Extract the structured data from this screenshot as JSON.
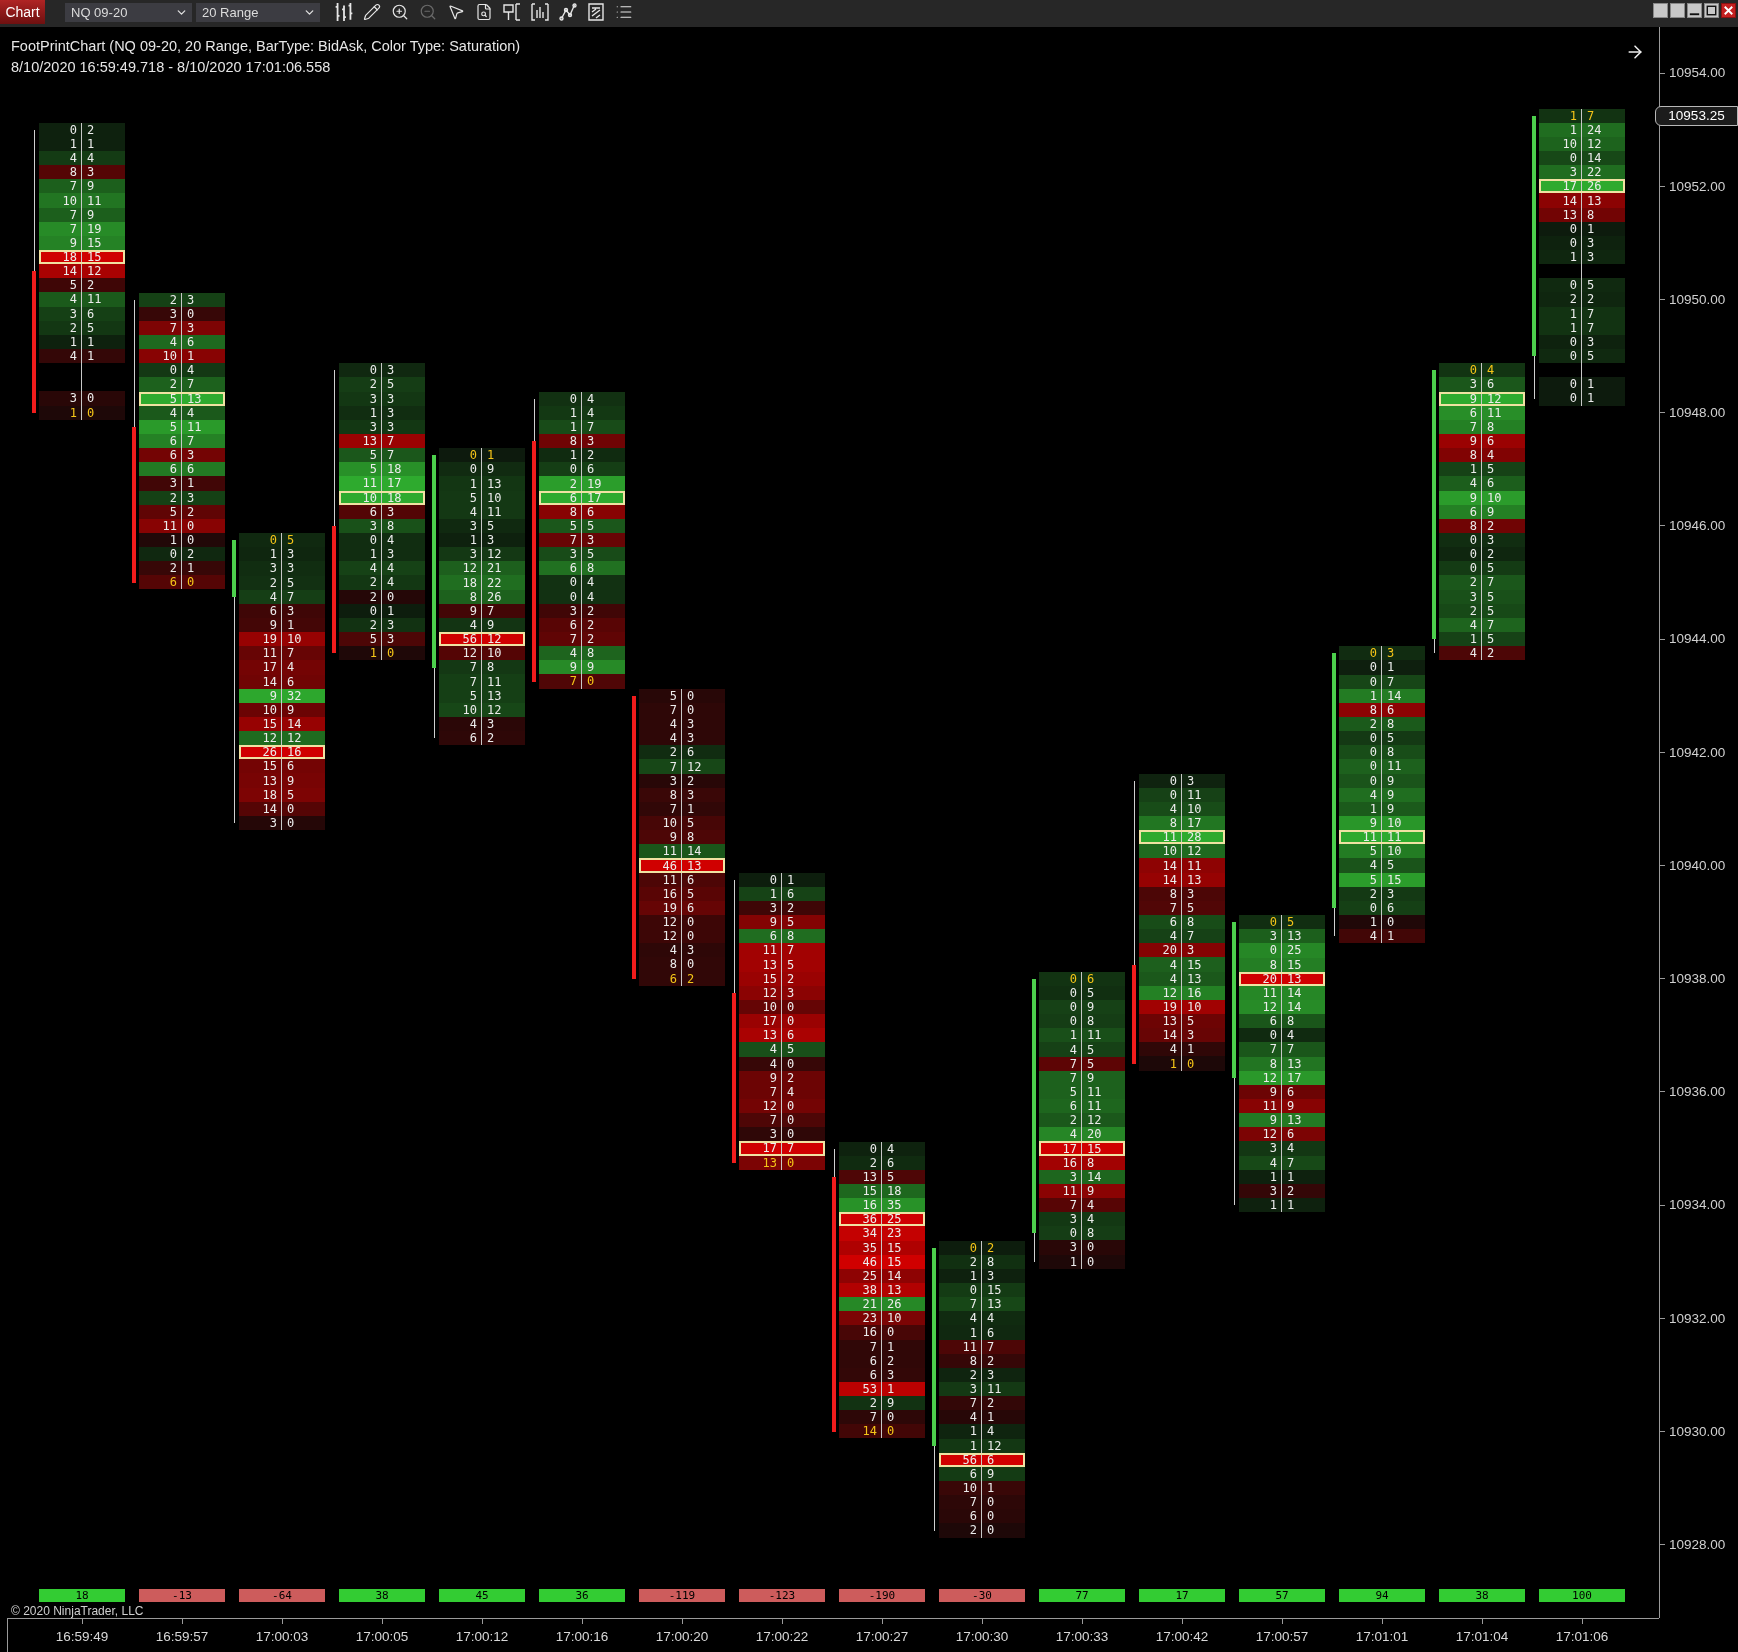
{
  "toolbar": {
    "tab": "Chart",
    "instrument": "NQ 09-20",
    "bar_type": "20 Range",
    "tools": [
      {
        "disabled": false
      },
      {
        "disabled": false
      },
      {
        "disabled": false
      },
      {
        "disabled": true
      },
      {
        "disabled": false
      },
      {
        "disabled": false
      },
      {
        "disabled": false
      },
      {
        "disabled": false
      },
      {
        "disabled": false
      },
      {
        "disabled": false
      },
      {
        "disabled": false
      }
    ]
  },
  "chart": {
    "title": "FootPrintChart (NQ 09-20, 20 Range, BarType: BidAsk, Color Type: Saturation)",
    "time_range": "8/10/2020 16:59:49.718 - 8/10/2020 17:01:06.558"
  },
  "price_axis": {
    "labels": [
      "10954.00",
      "10952.00",
      "10950.00",
      "10948.00",
      "10946.00",
      "10944.00",
      "10942.00",
      "10940.00",
      "10938.00",
      "10936.00",
      "10934.00",
      "10932.00",
      "10930.00",
      "10928.00"
    ],
    "current_price": "10953.25"
  },
  "bars": [
    {
      "rows": [
        {
          "bid": "0",
          "ask": "2",
          "kind": "normal"
        },
        {
          "bid": "1",
          "ask": "1",
          "kind": "normal"
        },
        {
          "bid": "4",
          "ask": "4",
          "kind": "normal"
        },
        {
          "bid": "8",
          "ask": "3",
          "kind": "normal"
        },
        {
          "bid": "7",
          "ask": "9",
          "kind": "normal"
        },
        {
          "bid": "10",
          "ask": "11",
          "kind": "normal"
        },
        {
          "bid": "7",
          "ask": "9",
          "kind": "normal"
        },
        {
          "bid": "7",
          "ask": "19",
          "kind": "normal"
        },
        {
          "bid": "9",
          "ask": "15",
          "kind": "normal"
        },
        {
          "bid": "18",
          "ask": "15",
          "kind": "poc"
        },
        {
          "bid": "14",
          "ask": "12",
          "kind": "open"
        },
        {
          "bid": "5",
          "ask": "2",
          "kind": "normal"
        },
        {
          "bid": "4",
          "ask": "11",
          "kind": "normal"
        },
        {
          "bid": "3",
          "ask": "6",
          "kind": "normal"
        },
        {
          "bid": "2",
          "ask": "5",
          "kind": "normal"
        },
        {
          "bid": "1",
          "ask": "1",
          "kind": "normal"
        },
        {
          "bid": "4",
          "ask": "1",
          "kind": "normal"
        },
        {
          "kind": "gap"
        },
        {
          "kind": "gap"
        },
        {
          "bid": "3",
          "ask": "0",
          "kind": "normal"
        },
        {
          "bid": "1",
          "ask": "0",
          "kind": "close"
        }
      ]
    },
    {
      "rows": [
        {
          "bid": "2",
          "ask": "3",
          "kind": "normal"
        },
        {
          "bid": "3",
          "ask": "0",
          "kind": "normal"
        },
        {
          "bid": "7",
          "ask": "3",
          "kind": "normal"
        },
        {
          "bid": "4",
          "ask": "6",
          "kind": "normal"
        },
        {
          "bid": "10",
          "ask": "1",
          "kind": "normal"
        },
        {
          "bid": "0",
          "ask": "4",
          "kind": "normal"
        },
        {
          "bid": "2",
          "ask": "7",
          "kind": "normal"
        },
        {
          "bid": "5",
          "ask": "13",
          "kind": "poc"
        },
        {
          "bid": "4",
          "ask": "4",
          "kind": "normal"
        },
        {
          "bid": "5",
          "ask": "11",
          "kind": "open"
        },
        {
          "bid": "6",
          "ask": "7",
          "kind": "normal"
        },
        {
          "bid": "6",
          "ask": "3",
          "kind": "normal"
        },
        {
          "bid": "6",
          "ask": "6",
          "kind": "normal"
        },
        {
          "bid": "3",
          "ask": "1",
          "kind": "normal"
        },
        {
          "bid": "2",
          "ask": "3",
          "kind": "normal"
        },
        {
          "bid": "5",
          "ask": "2",
          "kind": "normal"
        },
        {
          "bid": "11",
          "ask": "0",
          "kind": "normal"
        },
        {
          "bid": "1",
          "ask": "0",
          "kind": "normal"
        },
        {
          "bid": "0",
          "ask": "2",
          "kind": "normal"
        },
        {
          "bid": "2",
          "ask": "1",
          "kind": "normal"
        },
        {
          "bid": "6",
          "ask": "0",
          "kind": "close"
        }
      ]
    },
    {
      "rows": [
        {
          "bid": "0",
          "ask": "5",
          "kind": "close"
        },
        {
          "bid": "1",
          "ask": "3",
          "kind": "normal"
        },
        {
          "bid": "3",
          "ask": "3",
          "kind": "normal"
        },
        {
          "bid": "2",
          "ask": "5",
          "kind": "normal"
        },
        {
          "bid": "4",
          "ask": "7",
          "kind": "open"
        },
        {
          "bid": "6",
          "ask": "3",
          "kind": "normal"
        },
        {
          "bid": "9",
          "ask": "1",
          "kind": "normal"
        },
        {
          "bid": "19",
          "ask": "10",
          "kind": "normal"
        },
        {
          "bid": "11",
          "ask": "7",
          "kind": "normal"
        },
        {
          "bid": "17",
          "ask": "4",
          "kind": "normal"
        },
        {
          "bid": "14",
          "ask": "6",
          "kind": "normal"
        },
        {
          "bid": "9",
          "ask": "32",
          "kind": "normal"
        },
        {
          "bid": "10",
          "ask": "9",
          "kind": "normal"
        },
        {
          "bid": "15",
          "ask": "14",
          "kind": "normal"
        },
        {
          "bid": "12",
          "ask": "12",
          "kind": "normal"
        },
        {
          "bid": "26",
          "ask": "16",
          "kind": "poc"
        },
        {
          "bid": "15",
          "ask": "6",
          "kind": "normal"
        },
        {
          "bid": "13",
          "ask": "9",
          "kind": "normal"
        },
        {
          "bid": "18",
          "ask": "5",
          "kind": "normal"
        },
        {
          "bid": "14",
          "ask": "0",
          "kind": "normal"
        },
        {
          "bid": "3",
          "ask": "0",
          "kind": "normal"
        }
      ]
    },
    {
      "rows": [
        {
          "bid": "0",
          "ask": "3",
          "kind": "normal"
        },
        {
          "bid": "2",
          "ask": "5",
          "kind": "normal"
        },
        {
          "bid": "3",
          "ask": "3",
          "kind": "normal"
        },
        {
          "bid": "1",
          "ask": "3",
          "kind": "normal"
        },
        {
          "bid": "3",
          "ask": "3",
          "kind": "normal"
        },
        {
          "bid": "13",
          "ask": "7",
          "kind": "normal"
        },
        {
          "bid": "5",
          "ask": "7",
          "kind": "normal"
        },
        {
          "bid": "5",
          "ask": "18",
          "kind": "normal"
        },
        {
          "bid": "11",
          "ask": "17",
          "kind": "normal"
        },
        {
          "bid": "10",
          "ask": "18",
          "kind": "poc"
        },
        {
          "bid": "6",
          "ask": "3",
          "kind": "normal"
        },
        {
          "bid": "3",
          "ask": "8",
          "kind": "open"
        },
        {
          "bid": "0",
          "ask": "4",
          "kind": "normal"
        },
        {
          "bid": "1",
          "ask": "3",
          "kind": "normal"
        },
        {
          "bid": "4",
          "ask": "4",
          "kind": "normal"
        },
        {
          "bid": "2",
          "ask": "4",
          "kind": "normal"
        },
        {
          "bid": "2",
          "ask": "0",
          "kind": "normal"
        },
        {
          "bid": "0",
          "ask": "1",
          "kind": "normal"
        },
        {
          "bid": "2",
          "ask": "3",
          "kind": "normal"
        },
        {
          "bid": "5",
          "ask": "3",
          "kind": "normal"
        },
        {
          "bid": "1",
          "ask": "0",
          "kind": "close"
        }
      ]
    },
    {
      "rows": [
        {
          "bid": "0",
          "ask": "1",
          "kind": "close"
        },
        {
          "bid": "0",
          "ask": "9",
          "kind": "normal"
        },
        {
          "bid": "1",
          "ask": "13",
          "kind": "normal"
        },
        {
          "bid": "5",
          "ask": "10",
          "kind": "normal"
        },
        {
          "bid": "4",
          "ask": "11",
          "kind": "normal"
        },
        {
          "bid": "3",
          "ask": "5",
          "kind": "normal"
        },
        {
          "bid": "1",
          "ask": "3",
          "kind": "normal"
        },
        {
          "bid": "3",
          "ask": "12",
          "kind": "normal"
        },
        {
          "bid": "12",
          "ask": "21",
          "kind": "normal"
        },
        {
          "bid": "18",
          "ask": "22",
          "kind": "normal"
        },
        {
          "bid": "8",
          "ask": "26",
          "kind": "normal"
        },
        {
          "bid": "9",
          "ask": "7",
          "kind": "normal"
        },
        {
          "bid": "4",
          "ask": "9",
          "kind": "normal"
        },
        {
          "bid": "56",
          "ask": "12",
          "kind": "poc"
        },
        {
          "bid": "12",
          "ask": "10",
          "kind": "normal"
        },
        {
          "bid": "7",
          "ask": "8",
          "kind": "open"
        },
        {
          "bid": "7",
          "ask": "11",
          "kind": "normal"
        },
        {
          "bid": "5",
          "ask": "13",
          "kind": "normal"
        },
        {
          "bid": "10",
          "ask": "12",
          "kind": "normal"
        },
        {
          "bid": "4",
          "ask": "3",
          "kind": "normal"
        },
        {
          "bid": "6",
          "ask": "2",
          "kind": "normal"
        }
      ]
    },
    {
      "rows": [
        {
          "bid": "0",
          "ask": "4",
          "kind": "normal"
        },
        {
          "bid": "1",
          "ask": "4",
          "kind": "normal"
        },
        {
          "bid": "1",
          "ask": "7",
          "kind": "normal"
        },
        {
          "bid": "8",
          "ask": "3",
          "kind": "open"
        },
        {
          "bid": "1",
          "ask": "2",
          "kind": "normal"
        },
        {
          "bid": "0",
          "ask": "6",
          "kind": "normal"
        },
        {
          "bid": "2",
          "ask": "19",
          "kind": "normal"
        },
        {
          "bid": "6",
          "ask": "17",
          "kind": "poc"
        },
        {
          "bid": "8",
          "ask": "6",
          "kind": "normal"
        },
        {
          "bid": "5",
          "ask": "5",
          "kind": "normal"
        },
        {
          "bid": "7",
          "ask": "3",
          "kind": "normal"
        },
        {
          "bid": "3",
          "ask": "5",
          "kind": "normal"
        },
        {
          "bid": "6",
          "ask": "8",
          "kind": "normal"
        },
        {
          "bid": "0",
          "ask": "4",
          "kind": "normal"
        },
        {
          "bid": "0",
          "ask": "4",
          "kind": "normal"
        },
        {
          "bid": "3",
          "ask": "2",
          "kind": "normal"
        },
        {
          "bid": "6",
          "ask": "2",
          "kind": "normal"
        },
        {
          "bid": "7",
          "ask": "2",
          "kind": "normal"
        },
        {
          "bid": "4",
          "ask": "8",
          "kind": "normal"
        },
        {
          "bid": "9",
          "ask": "9",
          "kind": "normal"
        },
        {
          "bid": "7",
          "ask": "0",
          "kind": "close"
        }
      ]
    },
    {
      "rows": [
        {
          "bid": "5",
          "ask": "0",
          "kind": "open"
        },
        {
          "bid": "7",
          "ask": "0",
          "kind": "normal"
        },
        {
          "bid": "4",
          "ask": "3",
          "kind": "normal"
        },
        {
          "bid": "4",
          "ask": "3",
          "kind": "normal"
        },
        {
          "bid": "2",
          "ask": "6",
          "kind": "normal"
        },
        {
          "bid": "7",
          "ask": "12",
          "kind": "normal"
        },
        {
          "bid": "3",
          "ask": "2",
          "kind": "normal"
        },
        {
          "bid": "8",
          "ask": "3",
          "kind": "normal"
        },
        {
          "bid": "7",
          "ask": "1",
          "kind": "normal"
        },
        {
          "bid": "10",
          "ask": "5",
          "kind": "normal"
        },
        {
          "bid": "9",
          "ask": "8",
          "kind": "normal"
        },
        {
          "bid": "11",
          "ask": "14",
          "kind": "normal"
        },
        {
          "bid": "46",
          "ask": "13",
          "kind": "poc"
        },
        {
          "bid": "11",
          "ask": "6",
          "kind": "normal"
        },
        {
          "bid": "16",
          "ask": "5",
          "kind": "normal"
        },
        {
          "bid": "19",
          "ask": "6",
          "kind": "normal"
        },
        {
          "bid": "12",
          "ask": "0",
          "kind": "normal"
        },
        {
          "bid": "12",
          "ask": "0",
          "kind": "normal"
        },
        {
          "bid": "4",
          "ask": "3",
          "kind": "normal"
        },
        {
          "bid": "8",
          "ask": "0",
          "kind": "normal"
        },
        {
          "bid": "6",
          "ask": "2",
          "kind": "close"
        }
      ]
    },
    {
      "rows": [
        {
          "bid": "0",
          "ask": "1",
          "kind": "normal"
        },
        {
          "bid": "1",
          "ask": "6",
          "kind": "normal"
        },
        {
          "bid": "3",
          "ask": "2",
          "kind": "normal"
        },
        {
          "bid": "9",
          "ask": "5",
          "kind": "normal"
        },
        {
          "bid": "6",
          "ask": "8",
          "kind": "normal"
        },
        {
          "bid": "11",
          "ask": "7",
          "kind": "normal"
        },
        {
          "bid": "13",
          "ask": "5",
          "kind": "normal"
        },
        {
          "bid": "15",
          "ask": "2",
          "kind": "normal"
        },
        {
          "bid": "12",
          "ask": "3",
          "kind": "open"
        },
        {
          "bid": "10",
          "ask": "0",
          "kind": "normal"
        },
        {
          "bid": "17",
          "ask": "0",
          "kind": "normal"
        },
        {
          "bid": "13",
          "ask": "6",
          "kind": "normal"
        },
        {
          "bid": "4",
          "ask": "5",
          "kind": "normal"
        },
        {
          "bid": "4",
          "ask": "0",
          "kind": "normal"
        },
        {
          "bid": "9",
          "ask": "2",
          "kind": "normal"
        },
        {
          "bid": "7",
          "ask": "4",
          "kind": "normal"
        },
        {
          "bid": "12",
          "ask": "0",
          "kind": "normal"
        },
        {
          "bid": "7",
          "ask": "0",
          "kind": "normal"
        },
        {
          "bid": "3",
          "ask": "0",
          "kind": "normal"
        },
        {
          "bid": "17",
          "ask": "7",
          "kind": "poc"
        },
        {
          "bid": "13",
          "ask": "0",
          "kind": "close"
        }
      ]
    },
    {
      "rows": [
        {
          "bid": "0",
          "ask": "4",
          "kind": "normal"
        },
        {
          "bid": "2",
          "ask": "6",
          "kind": "normal"
        },
        {
          "bid": "13",
          "ask": "5",
          "kind": "open"
        },
        {
          "bid": "15",
          "ask": "18",
          "kind": "normal"
        },
        {
          "bid": "16",
          "ask": "35",
          "kind": "normal"
        },
        {
          "bid": "36",
          "ask": "25",
          "kind": "poc"
        },
        {
          "bid": "34",
          "ask": "23",
          "kind": "normal"
        },
        {
          "bid": "35",
          "ask": "15",
          "kind": "normal"
        },
        {
          "bid": "46",
          "ask": "15",
          "kind": "normal"
        },
        {
          "bid": "25",
          "ask": "14",
          "kind": "normal"
        },
        {
          "bid": "38",
          "ask": "13",
          "kind": "normal"
        },
        {
          "bid": "21",
          "ask": "26",
          "kind": "normal"
        },
        {
          "bid": "23",
          "ask": "10",
          "kind": "normal"
        },
        {
          "bid": "16",
          "ask": "0",
          "kind": "normal"
        },
        {
          "bid": "7",
          "ask": "1",
          "kind": "normal"
        },
        {
          "bid": "6",
          "ask": "2",
          "kind": "normal"
        },
        {
          "bid": "6",
          "ask": "3",
          "kind": "normal"
        },
        {
          "bid": "53",
          "ask": "1",
          "kind": "normal"
        },
        {
          "bid": "2",
          "ask": "9",
          "kind": "normal"
        },
        {
          "bid": "7",
          "ask": "0",
          "kind": "normal"
        },
        {
          "bid": "14",
          "ask": "0",
          "kind": "close"
        }
      ]
    },
    {
      "rows": [
        {
          "bid": "0",
          "ask": "2",
          "kind": "close"
        },
        {
          "bid": "2",
          "ask": "8",
          "kind": "normal"
        },
        {
          "bid": "1",
          "ask": "3",
          "kind": "normal"
        },
        {
          "bid": "0",
          "ask": "15",
          "kind": "normal"
        },
        {
          "bid": "7",
          "ask": "13",
          "kind": "normal"
        },
        {
          "bid": "4",
          "ask": "4",
          "kind": "normal"
        },
        {
          "bid": "1",
          "ask": "6",
          "kind": "normal"
        },
        {
          "bid": "11",
          "ask": "7",
          "kind": "normal"
        },
        {
          "bid": "8",
          "ask": "2",
          "kind": "normal"
        },
        {
          "bid": "2",
          "ask": "3",
          "kind": "normal"
        },
        {
          "bid": "3",
          "ask": "11",
          "kind": "normal"
        },
        {
          "bid": "7",
          "ask": "2",
          "kind": "normal"
        },
        {
          "bid": "4",
          "ask": "1",
          "kind": "normal"
        },
        {
          "bid": "1",
          "ask": "4",
          "kind": "normal"
        },
        {
          "bid": "1",
          "ask": "12",
          "kind": "open"
        },
        {
          "bid": "56",
          "ask": "6",
          "kind": "poc"
        },
        {
          "bid": "6",
          "ask": "9",
          "kind": "normal"
        },
        {
          "bid": "10",
          "ask": "1",
          "kind": "normal"
        },
        {
          "bid": "7",
          "ask": "0",
          "kind": "normal"
        },
        {
          "bid": "6",
          "ask": "0",
          "kind": "normal"
        },
        {
          "bid": "2",
          "ask": "0",
          "kind": "normal"
        }
      ]
    },
    {
      "rows": [
        {
          "bid": "0",
          "ask": "6",
          "kind": "close"
        },
        {
          "bid": "0",
          "ask": "5",
          "kind": "normal"
        },
        {
          "bid": "0",
          "ask": "9",
          "kind": "normal"
        },
        {
          "bid": "0",
          "ask": "8",
          "kind": "normal"
        },
        {
          "bid": "1",
          "ask": "11",
          "kind": "normal"
        },
        {
          "bid": "4",
          "ask": "5",
          "kind": "normal"
        },
        {
          "bid": "7",
          "ask": "5",
          "kind": "normal"
        },
        {
          "bid": "7",
          "ask": "9",
          "kind": "normal"
        },
        {
          "bid": "5",
          "ask": "11",
          "kind": "normal"
        },
        {
          "bid": "6",
          "ask": "11",
          "kind": "normal"
        },
        {
          "bid": "2",
          "ask": "12",
          "kind": "normal"
        },
        {
          "bid": "4",
          "ask": "20",
          "kind": "normal"
        },
        {
          "bid": "17",
          "ask": "15",
          "kind": "poc"
        },
        {
          "bid": "16",
          "ask": "8",
          "kind": "normal"
        },
        {
          "bid": "3",
          "ask": "14",
          "kind": "normal"
        },
        {
          "bid": "11",
          "ask": "9",
          "kind": "normal"
        },
        {
          "bid": "7",
          "ask": "4",
          "kind": "normal"
        },
        {
          "bid": "3",
          "ask": "4",
          "kind": "normal"
        },
        {
          "bid": "0",
          "ask": "8",
          "kind": "open"
        },
        {
          "bid": "3",
          "ask": "0",
          "kind": "normal"
        },
        {
          "bid": "1",
          "ask": "0",
          "kind": "normal"
        }
      ]
    },
    {
      "rows": [
        {
          "bid": "0",
          "ask": "3",
          "kind": "normal"
        },
        {
          "bid": "0",
          "ask": "11",
          "kind": "normal"
        },
        {
          "bid": "4",
          "ask": "10",
          "kind": "normal"
        },
        {
          "bid": "8",
          "ask": "17",
          "kind": "normal"
        },
        {
          "bid": "11",
          "ask": "28",
          "kind": "poc"
        },
        {
          "bid": "10",
          "ask": "12",
          "kind": "normal"
        },
        {
          "bid": "14",
          "ask": "11",
          "kind": "normal"
        },
        {
          "bid": "14",
          "ask": "13",
          "kind": "normal"
        },
        {
          "bid": "8",
          "ask": "3",
          "kind": "normal"
        },
        {
          "bid": "7",
          "ask": "5",
          "kind": "normal"
        },
        {
          "bid": "6",
          "ask": "8",
          "kind": "normal"
        },
        {
          "bid": "4",
          "ask": "7",
          "kind": "normal"
        },
        {
          "bid": "20",
          "ask": "3",
          "kind": "normal"
        },
        {
          "bid": "4",
          "ask": "15",
          "kind": "open"
        },
        {
          "bid": "4",
          "ask": "13",
          "kind": "normal"
        },
        {
          "bid": "12",
          "ask": "16",
          "kind": "normal"
        },
        {
          "bid": "19",
          "ask": "10",
          "kind": "normal"
        },
        {
          "bid": "13",
          "ask": "5",
          "kind": "normal"
        },
        {
          "bid": "14",
          "ask": "3",
          "kind": "normal"
        },
        {
          "bid": "4",
          "ask": "1",
          "kind": "normal"
        },
        {
          "bid": "1",
          "ask": "0",
          "kind": "close"
        }
      ]
    },
    {
      "rows": [
        {
          "bid": "0",
          "ask": "5",
          "kind": "close"
        },
        {
          "bid": "3",
          "ask": "13",
          "kind": "normal"
        },
        {
          "bid": "0",
          "ask": "25",
          "kind": "normal"
        },
        {
          "bid": "8",
          "ask": "15",
          "kind": "normal"
        },
        {
          "bid": "20",
          "ask": "13",
          "kind": "poc"
        },
        {
          "bid": "11",
          "ask": "14",
          "kind": "normal"
        },
        {
          "bid": "12",
          "ask": "14",
          "kind": "normal"
        },
        {
          "bid": "6",
          "ask": "8",
          "kind": "normal"
        },
        {
          "bid": "0",
          "ask": "4",
          "kind": "normal"
        },
        {
          "bid": "7",
          "ask": "7",
          "kind": "normal"
        },
        {
          "bid": "8",
          "ask": "13",
          "kind": "normal"
        },
        {
          "bid": "12",
          "ask": "17",
          "kind": "open"
        },
        {
          "bid": "9",
          "ask": "6",
          "kind": "normal"
        },
        {
          "bid": "11",
          "ask": "9",
          "kind": "normal"
        },
        {
          "bid": "9",
          "ask": "13",
          "kind": "normal"
        },
        {
          "bid": "12",
          "ask": "6",
          "kind": "normal"
        },
        {
          "bid": "3",
          "ask": "4",
          "kind": "normal"
        },
        {
          "bid": "4",
          "ask": "7",
          "kind": "normal"
        },
        {
          "bid": "1",
          "ask": "1",
          "kind": "normal"
        },
        {
          "bid": "3",
          "ask": "2",
          "kind": "normal"
        },
        {
          "bid": "1",
          "ask": "1",
          "kind": "normal"
        }
      ]
    },
    {
      "rows": [
        {
          "bid": "0",
          "ask": "3",
          "kind": "close"
        },
        {
          "bid": "0",
          "ask": "1",
          "kind": "normal"
        },
        {
          "bid": "0",
          "ask": "7",
          "kind": "normal"
        },
        {
          "bid": "1",
          "ask": "14",
          "kind": "normal"
        },
        {
          "bid": "8",
          "ask": "6",
          "kind": "normal"
        },
        {
          "bid": "2",
          "ask": "8",
          "kind": "normal"
        },
        {
          "bid": "0",
          "ask": "5",
          "kind": "normal"
        },
        {
          "bid": "0",
          "ask": "8",
          "kind": "normal"
        },
        {
          "bid": "0",
          "ask": "11",
          "kind": "normal"
        },
        {
          "bid": "0",
          "ask": "9",
          "kind": "normal"
        },
        {
          "bid": "4",
          "ask": "9",
          "kind": "normal"
        },
        {
          "bid": "1",
          "ask": "9",
          "kind": "normal"
        },
        {
          "bid": "9",
          "ask": "10",
          "kind": "normal"
        },
        {
          "bid": "11",
          "ask": "11",
          "kind": "poc"
        },
        {
          "bid": "5",
          "ask": "10",
          "kind": "normal"
        },
        {
          "bid": "4",
          "ask": "5",
          "kind": "normal"
        },
        {
          "bid": "5",
          "ask": "15",
          "kind": "normal"
        },
        {
          "bid": "2",
          "ask": "3",
          "kind": "normal"
        },
        {
          "bid": "0",
          "ask": "6",
          "kind": "open"
        },
        {
          "bid": "1",
          "ask": "0",
          "kind": "normal"
        },
        {
          "bid": "4",
          "ask": "1",
          "kind": "normal"
        }
      ]
    },
    {
      "rows": [
        {
          "bid": "0",
          "ask": "4",
          "kind": "close"
        },
        {
          "bid": "3",
          "ask": "6",
          "kind": "normal"
        },
        {
          "bid": "9",
          "ask": "12",
          "kind": "poc"
        },
        {
          "bid": "6",
          "ask": "11",
          "kind": "normal"
        },
        {
          "bid": "7",
          "ask": "8",
          "kind": "normal"
        },
        {
          "bid": "9",
          "ask": "6",
          "kind": "normal"
        },
        {
          "bid": "8",
          "ask": "4",
          "kind": "normal"
        },
        {
          "bid": "1",
          "ask": "5",
          "kind": "normal"
        },
        {
          "bid": "4",
          "ask": "6",
          "kind": "normal"
        },
        {
          "bid": "9",
          "ask": "10",
          "kind": "normal"
        },
        {
          "bid": "6",
          "ask": "9",
          "kind": "normal"
        },
        {
          "bid": "8",
          "ask": "2",
          "kind": "normal"
        },
        {
          "bid": "0",
          "ask": "3",
          "kind": "normal"
        },
        {
          "bid": "0",
          "ask": "2",
          "kind": "normal"
        },
        {
          "bid": "0",
          "ask": "5",
          "kind": "normal"
        },
        {
          "bid": "2",
          "ask": "7",
          "kind": "normal"
        },
        {
          "bid": "3",
          "ask": "5",
          "kind": "normal"
        },
        {
          "bid": "2",
          "ask": "5",
          "kind": "normal"
        },
        {
          "bid": "4",
          "ask": "7",
          "kind": "normal"
        },
        {
          "bid": "1",
          "ask": "5",
          "kind": "open"
        },
        {
          "bid": "4",
          "ask": "2",
          "kind": "normal"
        }
      ]
    },
    {
      "rows": [
        {
          "bid": "1",
          "ask": "7",
          "kind": "close"
        },
        {
          "bid": "1",
          "ask": "24",
          "kind": "normal"
        },
        {
          "bid": "10",
          "ask": "12",
          "kind": "normal"
        },
        {
          "bid": "0",
          "ask": "14",
          "kind": "normal"
        },
        {
          "bid": "3",
          "ask": "22",
          "kind": "normal"
        },
        {
          "bid": "17",
          "ask": "26",
          "kind": "poc"
        },
        {
          "bid": "14",
          "ask": "13",
          "kind": "normal"
        },
        {
          "bid": "13",
          "ask": "8",
          "kind": "normal"
        },
        {
          "bid": "0",
          "ask": "1",
          "kind": "normal"
        },
        {
          "bid": "0",
          "ask": "3",
          "kind": "normal"
        },
        {
          "bid": "1",
          "ask": "3",
          "kind": "normal"
        },
        {
          "kind": "gap"
        },
        {
          "bid": "0",
          "ask": "5",
          "kind": "normal"
        },
        {
          "bid": "2",
          "ask": "2",
          "kind": "normal"
        },
        {
          "bid": "1",
          "ask": "7",
          "kind": "normal"
        },
        {
          "bid": "1",
          "ask": "7",
          "kind": "normal"
        },
        {
          "bid": "0",
          "ask": "3",
          "kind": "normal"
        },
        {
          "bid": "0",
          "ask": "5",
          "kind": "open"
        },
        {
          "kind": "gap"
        },
        {
          "bid": "0",
          "ask": "1",
          "kind": "normal"
        },
        {
          "bid": "0",
          "ask": "1",
          "kind": "normal"
        }
      ]
    }
  ],
  "deltas": [
    {
      "value": "18",
      "color": "#33cc33"
    },
    {
      "value": "-13",
      "color": "#cd5c5c"
    },
    {
      "value": "-64",
      "color": "#cd5c5c"
    },
    {
      "value": "38",
      "color": "#33cc33"
    },
    {
      "value": "45",
      "color": "#33cc33"
    },
    {
      "value": "36",
      "color": "#33cc33"
    },
    {
      "value": "-119",
      "color": "#cd5c5c"
    },
    {
      "value": "-123",
      "color": "#cd5c5c"
    },
    {
      "value": "-190",
      "color": "#cd5c5c"
    },
    {
      "value": "-30",
      "color": "#cd5c5c"
    },
    {
      "value": "77",
      "color": "#33cc33"
    },
    {
      "value": "17",
      "color": "#33cc33"
    },
    {
      "value": "57",
      "color": "#33cc33"
    },
    {
      "value": "94",
      "color": "#33cc33"
    },
    {
      "value": "38",
      "color": "#33cc33"
    },
    {
      "value": "100",
      "color": "#33cc33"
    }
  ],
  "copyright": "© 2020 NinjaTrader, LLC",
  "time_axis": [
    "16:59:49",
    "16:59:57",
    "17:00:03",
    "17:00:05",
    "17:00:12",
    "17:00:16",
    "17:00:20",
    "17:00:22",
    "17:00:27",
    "17:00:30",
    "17:00:33",
    "17:00:42",
    "17:00:57",
    "17:01:01",
    "17:01:04",
    "17:01:06"
  ]
}
